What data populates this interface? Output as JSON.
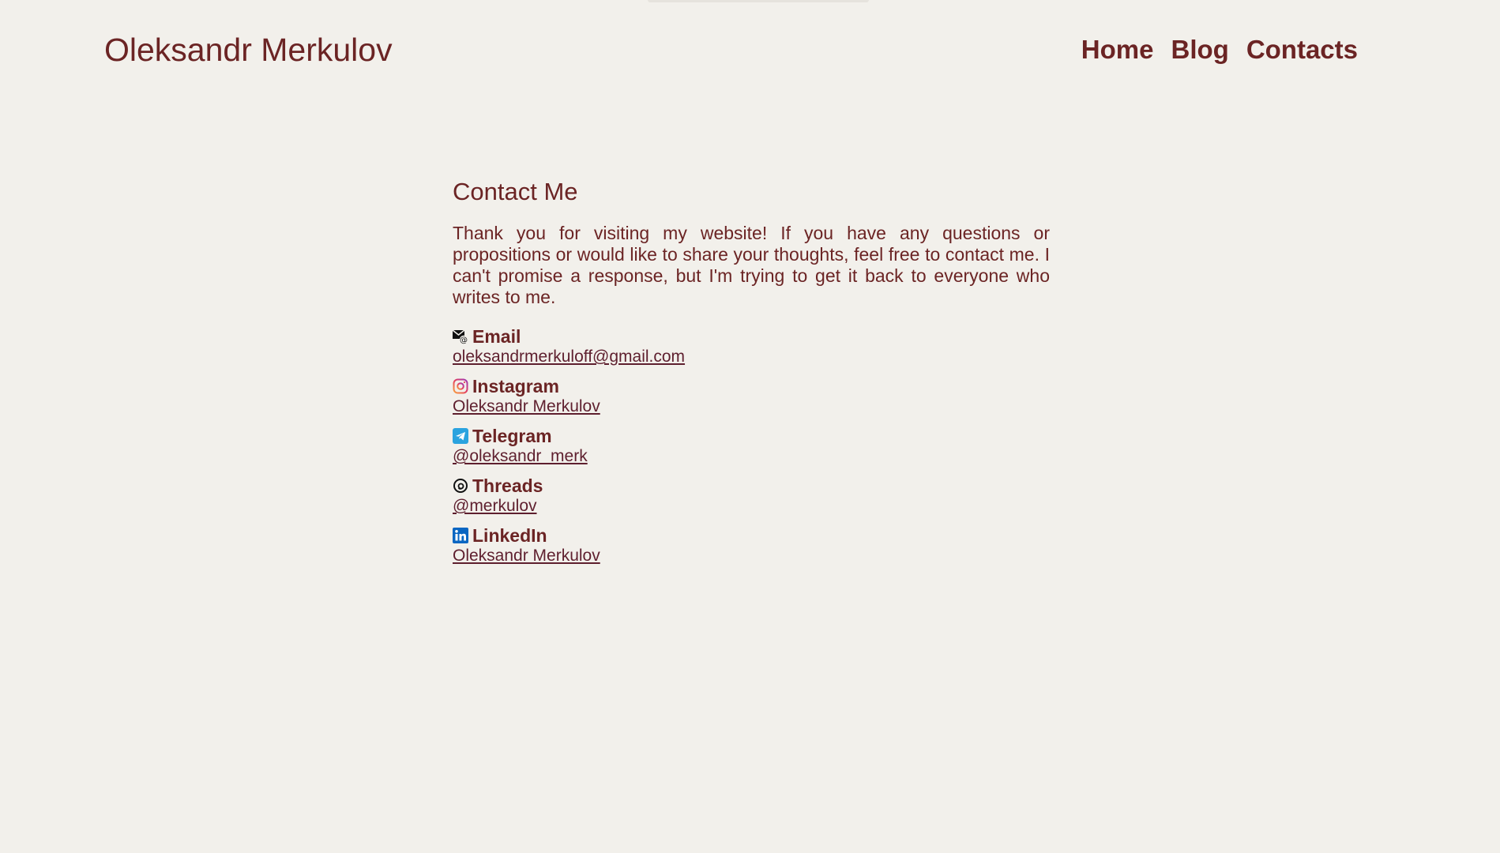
{
  "header": {
    "site_title": "Oleksandr Merkulov",
    "nav": [
      {
        "label": "Home"
      },
      {
        "label": "Blog"
      },
      {
        "label": "Contacts"
      }
    ]
  },
  "main": {
    "heading": "Contact Me",
    "intro": "Thank you for visiting my website! If you have any questions or propositions or would like to share your thoughts, feel free to contact me. I can't promise a response, but I'm trying to get it back to everyone who writes to me.",
    "contacts": [
      {
        "label": "Email",
        "link": "oleksandrmerkuloff@gmail.com",
        "icon": "email-icon"
      },
      {
        "label": "Instagram",
        "link": "Oleksandr Merkulov",
        "icon": "instagram-icon"
      },
      {
        "label": "Telegram",
        "link": "@oleksandr_merk",
        "icon": "telegram-icon"
      },
      {
        "label": "Threads",
        "link": "@merkulov",
        "icon": "threads-icon"
      },
      {
        "label": "LinkedIn",
        "link": "Oleksandr Merkulov",
        "icon": "linkedin-icon"
      }
    ]
  },
  "colors": {
    "background": "#f2f0eb",
    "text": "#6b2424",
    "link": "#5e1f2e",
    "telegram": "#2aa3df",
    "linkedin": "#0a66c2",
    "instagram": "#e4405f"
  }
}
